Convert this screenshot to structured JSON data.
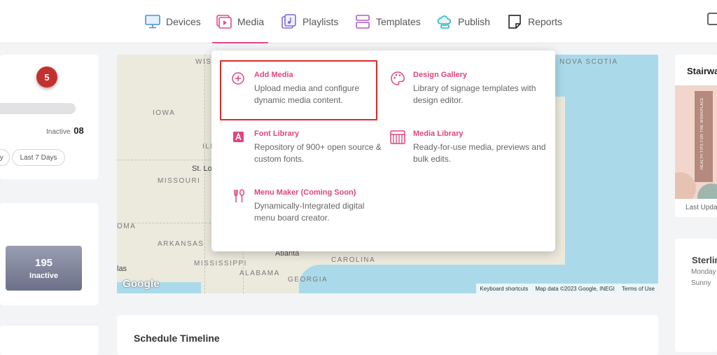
{
  "nav": {
    "items": [
      {
        "label": "Devices",
        "icon": "monitor-icon"
      },
      {
        "label": "Media",
        "icon": "play-media-icon",
        "active": true
      },
      {
        "label": "Playlists",
        "icon": "playlist-icon"
      },
      {
        "label": "Templates",
        "icon": "templates-icon"
      },
      {
        "label": "Publish",
        "icon": "cloud-publish-icon"
      },
      {
        "label": "Reports",
        "icon": "reports-icon"
      }
    ],
    "accent_color": "#e64a8a"
  },
  "dropdown": {
    "items": [
      {
        "title": "Add Media",
        "desc": "Upload media and configure dynamic media content.",
        "icon": "plus-circle-icon",
        "highlighted": true
      },
      {
        "title": "Design Gallery",
        "desc": "Library of signage templates with design editor.",
        "icon": "palette-icon"
      },
      {
        "title": "Font Library",
        "desc": "Repository of 900+ open source & custom fonts.",
        "icon": "font-icon"
      },
      {
        "title": "Media Library",
        "desc": "Ready-for-use media, previews and bulk edits.",
        "icon": "media-library-icon"
      },
      {
        "title": "Menu Maker (Coming Soon)",
        "desc": "Dynamically-Integrated digital menu board creator.",
        "icon": "fork-spoon-icon"
      }
    ],
    "highlight_color": "#e22a2a",
    "title_color": "#e0457f"
  },
  "left_panel": {
    "badge_count": "5",
    "inactive_label": "Inactive",
    "inactive_count": "08",
    "range_buttons": [
      "ay",
      "Last 7 Days"
    ],
    "inactive_box": {
      "count": "195",
      "label": "Inactive"
    }
  },
  "map": {
    "labels": {
      "wisc": "WISC",
      "iowa": "IOWA",
      "ili": "ILI",
      "st_louis": "St. Lo",
      "missouri": "MISSOURI",
      "oma": "OMA",
      "arkansas": "ARKANSAS",
      "mississippi": "MISSISSIPPI",
      "alabama": "ALABAMA",
      "georgia": "GEORGIA",
      "atlanta": "Atlanta",
      "las": "las",
      "carolina": "CAROLINA",
      "nova_scotia": "NOVA SCOTIA"
    },
    "google": "Google",
    "attribution": [
      "Keyboard shortcuts",
      "Map data ©2023 Google, INEGI",
      "Terms of Use"
    ]
  },
  "schedule": {
    "title": "Schedule Timeline"
  },
  "right_panel": {
    "card1": {
      "title": "Stairwa",
      "thumb_text": "HEALTH TIPS FOR THE WORKPLACE",
      "footer": "Last Upda"
    },
    "card2": {
      "title": "Sterlin",
      "line1": "Monday",
      "line2": "Sunny"
    }
  }
}
